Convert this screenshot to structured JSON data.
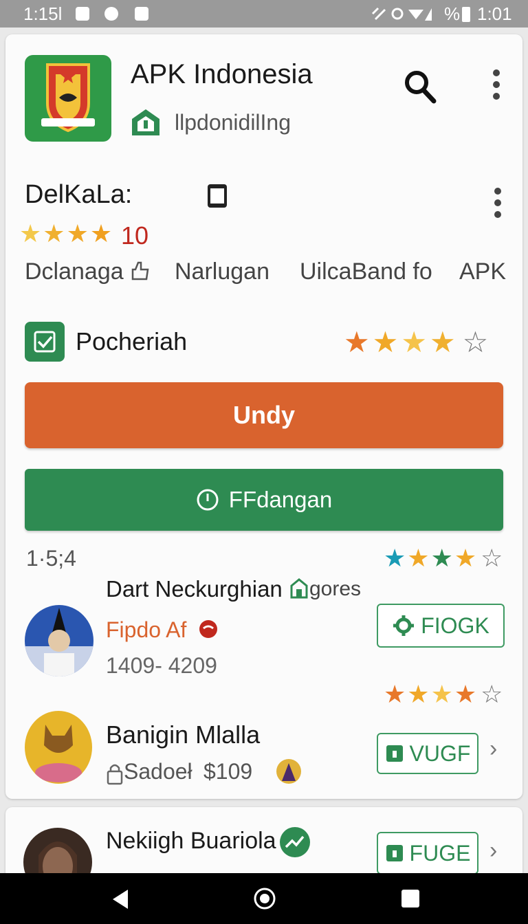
{
  "status_bar": {
    "left_time": "1:15l",
    "battery_pct": "%",
    "right_time": "1:01"
  },
  "header": {
    "app_title": "APK Indonesia",
    "subtitle": "llpdonidilIng"
  },
  "section": {
    "title": "DelKaLa:",
    "rating_value": "10",
    "tabs": [
      {
        "label": "Dclanaga"
      },
      {
        "label": "Narlugan"
      },
      {
        "label": "UilcaBand fo"
      },
      {
        "label": "APK"
      }
    ],
    "checkbox_label": "Pocheriah"
  },
  "buttons": {
    "primary_label": "Undy",
    "secondary_label": "FFdangan"
  },
  "list_meta": {
    "count": "1·5;4"
  },
  "list": [
    {
      "title": "Dart Neckurghian",
      "tag": "gores",
      "subtitle": "Fipdo Af",
      "detail": "1409- 4209",
      "action_label": "FIOGK"
    },
    {
      "title": "Banigin Mlalla",
      "subtitle": "Sadoeł",
      "price": "$109",
      "action_label": "VUGF"
    },
    {
      "title": "Nekiigh Buariola",
      "action_label": "FUGE"
    }
  ],
  "icons": {
    "search": "search-icon",
    "more": "more-vert-icon",
    "phone": "smartphone-icon",
    "check": "checkbox-icon",
    "clock": "clock-icon",
    "chevron": "chevron-right-icon"
  },
  "colors": {
    "brand_green": "#2e8b52",
    "accent_orange": "#d9632e",
    "star_gold": "#f0a828",
    "star_teal": "#1a9bb5"
  }
}
